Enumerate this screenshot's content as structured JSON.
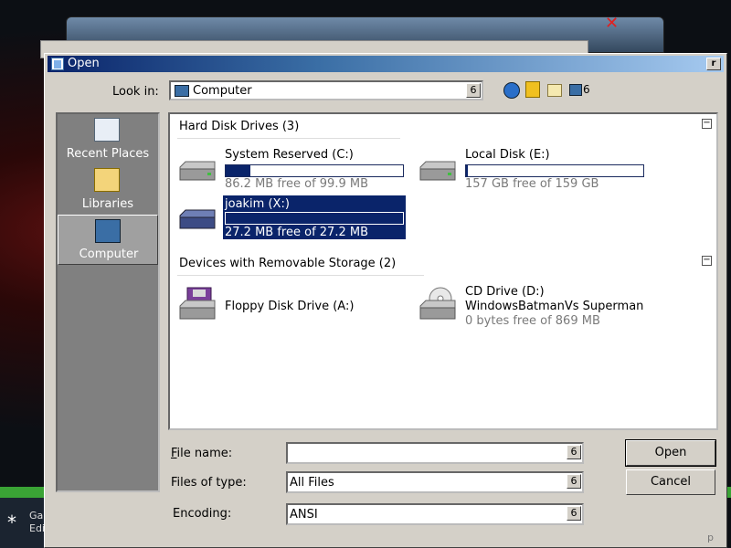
{
  "background": {
    "taskbar_text": "Ga Edi",
    "star_glyph": "*",
    "close_glyph": "✕"
  },
  "dialog": {
    "title": "Open",
    "close_glyph": "r"
  },
  "look_in": {
    "label": "Look in:",
    "value": "Computer",
    "dropdown_glyph": "6",
    "views_glyph": "6"
  },
  "places": [
    {
      "label": "Recent Places",
      "icon": "recent-places-icon"
    },
    {
      "label": "Libraries",
      "icon": "libraries-icon"
    },
    {
      "label": "Computer",
      "icon": "computer-icon",
      "selected": true
    }
  ],
  "groups": [
    {
      "title": "Hard Disk Drives (3)",
      "collapse_glyph": "−"
    },
    {
      "title": "Devices with Removable Storage (2)",
      "collapse_glyph": "−"
    }
  ],
  "drives": {
    "c": {
      "name": "System Reserved (C:)",
      "free": "86.2 MB free of 99.9 MB",
      "used_fraction": 0.14,
      "icon": "hard-drive-icon"
    },
    "e": {
      "name": "Local Disk (E:)",
      "free": "157 GB free of 159 GB",
      "used_fraction": 0.01,
      "icon": "hard-drive-icon"
    },
    "x": {
      "name": "joakim (X:)",
      "free": "27.2 MB free of 27.2 MB",
      "used_fraction": 0.0,
      "icon": "network-drive-icon",
      "selected": true
    },
    "a": {
      "name": "Floppy Disk Drive (A:)",
      "icon": "floppy-drive-icon"
    },
    "d": {
      "name": "CD Drive (D:)",
      "name2": "WindowsBatmanVs Superman",
      "free": "0 bytes free of 869 MB",
      "icon": "cd-drive-icon"
    }
  },
  "fields": {
    "file_name": {
      "label": "File name:",
      "value": "",
      "dropdown_glyph": "6"
    },
    "file_type": {
      "label": "Files of type:",
      "value": "All Files",
      "dropdown_glyph": "6"
    },
    "encoding": {
      "label": "Encoding:",
      "value": "ANSI",
      "dropdown_glyph": "6"
    }
  },
  "buttons": {
    "open": "Open",
    "cancel": "Cancel"
  },
  "grip_glyph": "p",
  "colors": {
    "selection": "#0a246a",
    "face": "#d4d0c8",
    "places_bg": "#808080"
  }
}
